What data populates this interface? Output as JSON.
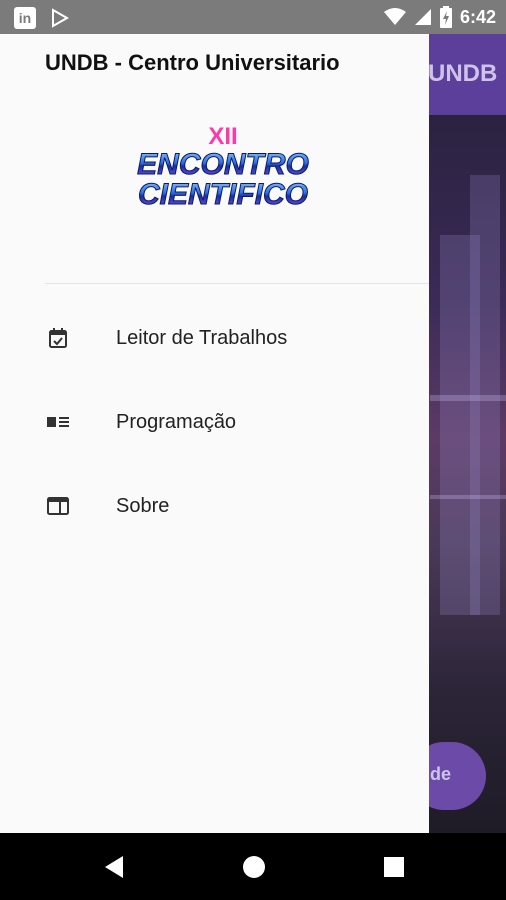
{
  "status_bar": {
    "time": "6:42",
    "left_icons": [
      "linkedin-icon",
      "play-store-icon"
    ],
    "right_icons": [
      "wifi-icon",
      "signal-icon",
      "battery-charging-icon"
    ]
  },
  "background_app": {
    "title": "UNDB",
    "fab_label": "de"
  },
  "drawer": {
    "title": "UNDB - Centro Universitario",
    "logo": {
      "line1": "XII",
      "line2": "ENCONTRO",
      "line3": "CIENTIFICO"
    },
    "items": [
      {
        "label": "Leitor de Trabalhos",
        "icon": "calendar-check-icon"
      },
      {
        "label": "Programação",
        "icon": "featured-list-icon"
      },
      {
        "label": "Sobre",
        "icon": "web-window-icon"
      }
    ]
  },
  "nav_bar": {
    "buttons": [
      "back",
      "home",
      "recents"
    ]
  },
  "colors": {
    "primary": "#5b3f9a",
    "logo_pink": "#ff3aa8",
    "logo_blue": "#2f6fe0",
    "drawer_bg": "#fafafa"
  }
}
